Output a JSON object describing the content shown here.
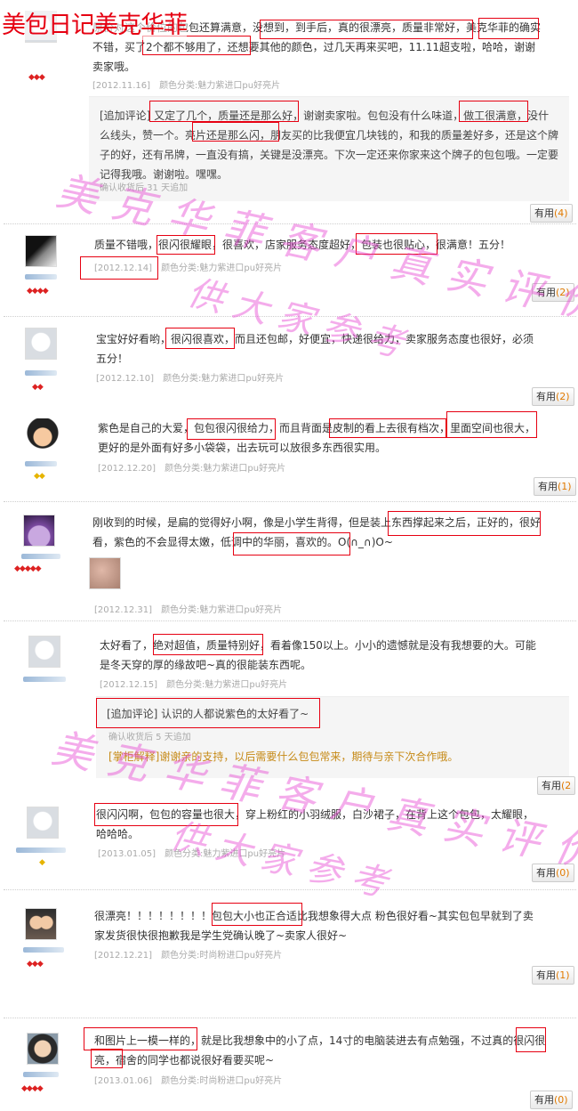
{
  "page_title": "美包日记美克华菲",
  "watermark": {
    "line1": "美克华菲客户真实评价",
    "line2": "供大家参考"
  },
  "reviews": [
    {
      "text": "原价对这个价位的包包还算满意，没想到，到手后，真的很漂亮，质量非常好，美克华菲的确实不错，买了2个都不够用了，还想要其他的颜色，过几天再来买吧，11.11超支啦，哈哈，谢谢卖家哦。",
      "date": "[2012.11.16]",
      "sku": "颜色分类:魅力紫进口pu好亮片",
      "append": {
        "text": "[追加评论] 又定了几个，质量还是那么好，谢谢卖家啦。包包没有什么味道，做工很满意，没什么线头，赞一个。亮片还是那么闪，朋友买的比我便宜几块钱的，和我的质量差好多，还是这个牌子的好，还有吊牌，一直没有搞，关键是没漂亮。下次一定还来你家来这个牌子的包包哦。一定要记得我哦。谢谢啦。嘿嘿。",
        "meta": "确认收货后 31 天追加"
      },
      "useful_label": "有用",
      "useful_count": "(4)"
    },
    {
      "text": "质量不错哦，很闪很耀眼，很喜欢，店家服务态度超好，包装也很贴心，很满意！五分！",
      "date": "[2012.12.14]",
      "sku": "颜色分类:魅力紫进口pu好亮片",
      "useful_label": "有用",
      "useful_count": "(2)"
    },
    {
      "text": "宝宝好好看哟，很闪很喜欢，而且还包邮，好便宜，快递很给力，卖家服务态度也很好，必须五分！",
      "date": "[2012.12.10]",
      "sku": "颜色分类:魅力紫进口pu好亮片",
      "useful_label": "有用",
      "useful_count": "(2)"
    },
    {
      "text": "紫色是自己的大爱，包包很闪很给力，而且背面是皮制的看上去很有档次，里面空间也很大，更好的是外面有好多小袋袋，出去玩可以放很多东西很实用。",
      "date": "[2012.12.20]",
      "sku": "颜色分类:魅力紫进口pu好亮片",
      "useful_label": "有用",
      "useful_count": "(1)"
    },
    {
      "text": "刚收到的时候，是扁的觉得好小啊，像是小学生背得，但是装上东西撑起来之后，正好的，很好看，紫色的不会显得太嫩，低调中的华丽，喜欢的。O(∩_∩)O~",
      "date": "[2012.12.31]",
      "sku": "颜色分类:魅力紫进口pu好亮片"
    },
    {
      "text": "太好看了，绝对超值，质量特别好，看着像150以上。小小的遗憾就是没有我想要的大。可能是冬天穿的厚的缘故吧~真的很能装东西呢。",
      "date": "[2012.12.15]",
      "sku": "颜色分类:魅力紫进口pu好亮片",
      "append": {
        "text": "[追加评论] 认识的人都说紫色的太好看了~",
        "meta": "确认收货后 5 天追加"
      },
      "reply": "[掌柜解释]谢谢亲的支持，以后需要什么包包常来，期待与亲下次合作哦。",
      "useful_label": "有用",
      "useful_count": "(2"
    },
    {
      "text": "很闪闪啊，包包的容量也很大，穿上粉红的小羽绒服，白沙裙子，在背上这个包包，太耀眼，哈哈哈。",
      "date": "[2013.01.05]",
      "sku": "颜色分类:魅力紫进口pu好亮片",
      "useful_label": "有用",
      "useful_count": "(0)"
    },
    {
      "text": "很漂亮！！！！！！！！包包大小也正合适比我想象得大点 粉色很好看~其实包包早就到了卖家发货很快很抱歉我是学生党确认晚了~卖家人很好~",
      "date": "[2012.12.21]",
      "sku": "颜色分类:时尚粉进口pu好亮片",
      "useful_label": "有用",
      "useful_count": "(1)"
    },
    {
      "text": "和图片上一模一样的，就是比我想象中的小了点，14寸的电脑装进去有点勉强，不过真的很闪很亮，宿舍的同学也都说很好看要买呢~",
      "date": "[2013.01.06]",
      "sku": "颜色分类:时尚粉进口pu好亮片",
      "useful_label": "有用",
      "useful_count": "(0)"
    }
  ]
}
